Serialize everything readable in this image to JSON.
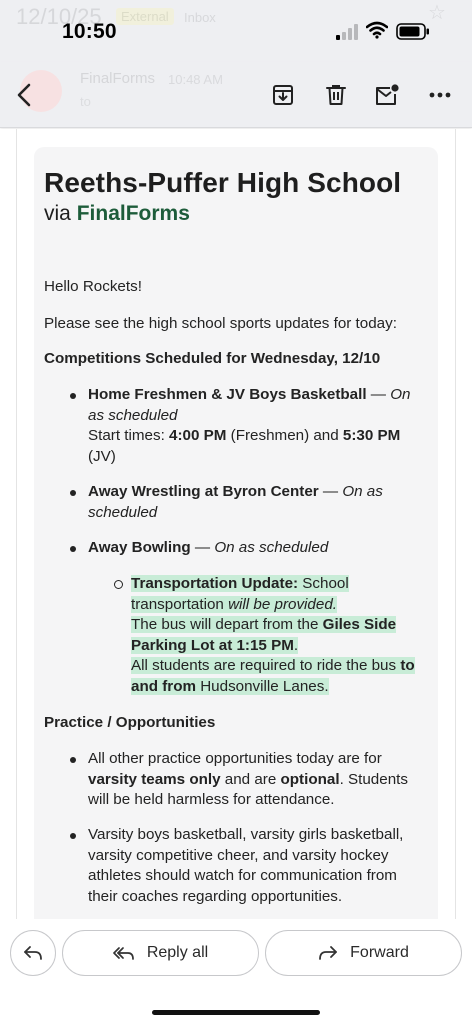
{
  "status_bar": {
    "time": "10:50",
    "ghost_date": "12/10/25",
    "ghost_tag": "External",
    "ghost_inbox": "Inbox"
  },
  "toolbar": {
    "ghost_sender": "FinalForms",
    "ghost_time": "10:48 AM",
    "ghost_to": "to",
    "icons": [
      "back-icon",
      "archive-icon",
      "delete-icon",
      "mark-unread-icon",
      "more-icon"
    ]
  },
  "email": {
    "title": "Reeths-Puffer High School",
    "via_prefix": "via",
    "via_brand": "FinalForms",
    "greeting": "Hello Rockets!",
    "intro": "Please see the high school sports updates for today:",
    "competitions_heading": "Competitions Scheduled for Wednesday, 12/10",
    "competitions": [
      {
        "event": "Home Freshmen & JV Boys Basketball",
        "dash": " — ",
        "status": "On as scheduled",
        "start_prefix": "Start times: ",
        "time1": "4:00 PM",
        "time1_suffix": " (Freshmen) and ",
        "time2": "5:30 PM",
        "time2_suffix": " (JV)"
      },
      {
        "event": "Away Wrestling at Byron Center",
        "dash": " — ",
        "status": "On as scheduled"
      },
      {
        "event": "Away Bowling",
        "dash": " — ",
        "status": "On as scheduled"
      }
    ],
    "transport": {
      "label": "Transportation Update:",
      "p1": " School transportation ",
      "p1_ital": "will be provided.",
      "p2": "The bus will depart from the ",
      "p2_bold": "Giles Side Parking Lot at 1:15 PM",
      "p2_end": ".",
      "p3": "All students are required to ride the bus ",
      "p3_bold": "to and from",
      "p3_end": " Hudsonville Lanes."
    },
    "practice_heading": "Practice / Opportunities",
    "practice": [
      {
        "t1": "All other practice opportunities today are for ",
        "b1": "varsity teams only",
        "t2": " and are ",
        "b2": "optional",
        "t3": ". Students will be held harmless for attendance."
      },
      {
        "t1": "Varsity boys basketball, varsity girls basketball, varsity competitive cheer, and varsity hockey athletes should watch for communication from their coaches regarding opportunities."
      }
    ]
  },
  "actions": {
    "reply_all": "Reply all",
    "forward": "Forward"
  },
  "colors": {
    "brand_green": "#1d5c3a",
    "highlight": "#c8ecd7",
    "chrome": "#eeeff2"
  }
}
